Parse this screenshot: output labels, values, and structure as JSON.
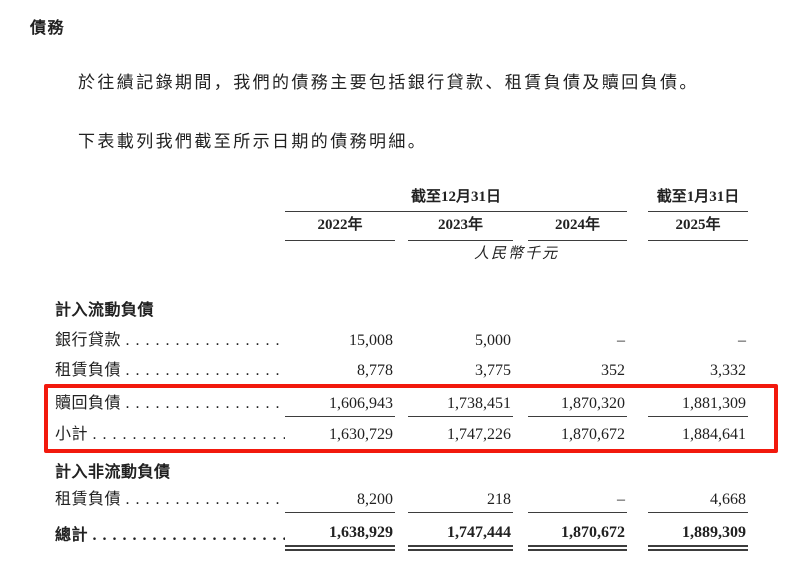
{
  "title": "債務",
  "paragraphs": [
    "於往績記錄期間，我們的債務主要包括銀行貸款、租賃負債及贖回負債。",
    "下表載列我們截至所示日期的債務明細。"
  ],
  "table": {
    "group_headers": [
      "截至12月31日",
      "截至1月31日"
    ],
    "years": [
      "2022年",
      "2023年",
      "2024年",
      "2025年"
    ],
    "unit": "人民幣千元",
    "leader_dots": ". . . . . . . . . . . . . . . . . . . . . . . . . . . . . .",
    "rows": [
      {
        "kind": "section",
        "label": "計入流動負債"
      },
      {
        "kind": "item",
        "label": "銀行貸款",
        "values": [
          "15,008",
          "5,000",
          "–",
          "–"
        ]
      },
      {
        "kind": "item",
        "label": "租賃負債",
        "values": [
          "8,778",
          "3,775",
          "352",
          "3,332"
        ]
      },
      {
        "kind": "item",
        "label": "贖回負債",
        "rule": "single",
        "highlighted": true,
        "values": [
          "1,606,943",
          "1,738,451",
          "1,870,320",
          "1,881,309"
        ]
      },
      {
        "kind": "item",
        "label": "小計",
        "highlighted": true,
        "values": [
          "1,630,729",
          "1,747,226",
          "1,870,672",
          "1,884,641"
        ]
      },
      {
        "kind": "section",
        "label": "計入非流動負債"
      },
      {
        "kind": "item",
        "label": "租賃負債",
        "rule": "single",
        "values": [
          "8,200",
          "218",
          "–",
          "4,668"
        ]
      },
      {
        "kind": "total",
        "label": "總計",
        "rule": "double",
        "values": [
          "1,638,929",
          "1,747,444",
          "1,870,672",
          "1,889,309"
        ]
      }
    ],
    "highlight_color": "#f2190d"
  }
}
